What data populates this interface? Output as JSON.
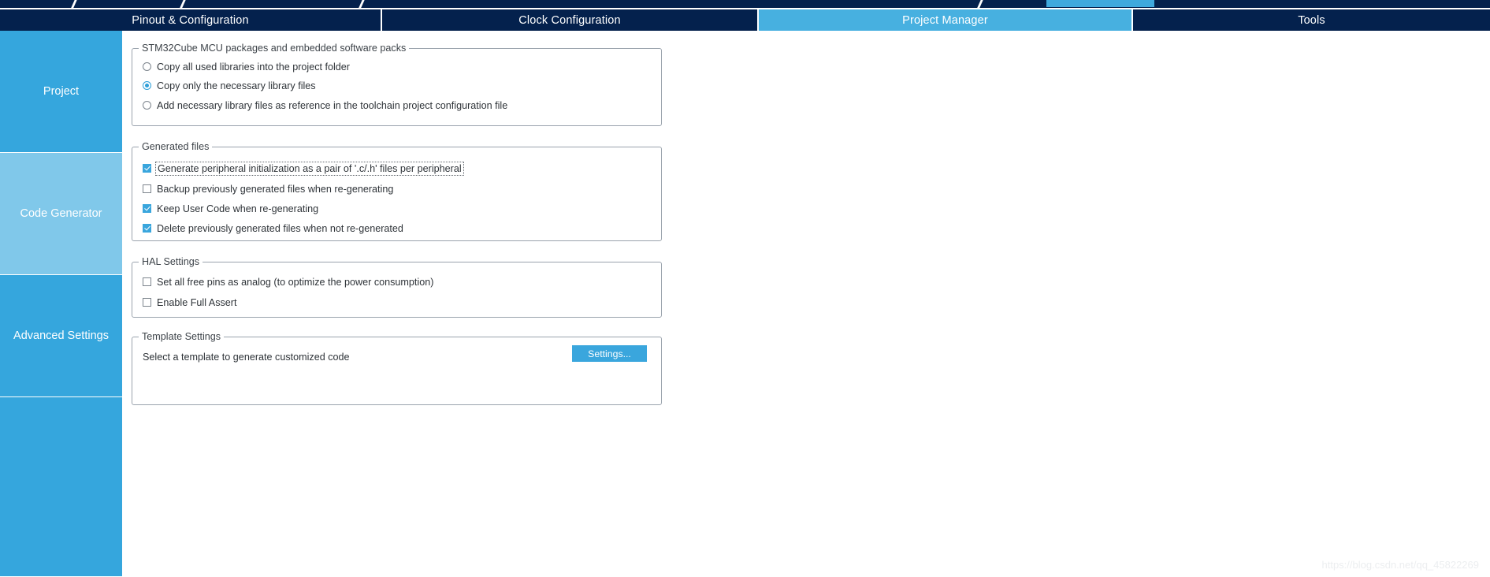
{
  "topbar": {
    "progress_chip_color": "#3fa9dd",
    "ribbon_color": "#04214d"
  },
  "tabs": [
    {
      "label": "Pinout & Configuration",
      "active": false
    },
    {
      "label": "Clock Configuration",
      "active": false
    },
    {
      "label": "Project Manager",
      "active": true
    },
    {
      "label": "Tools",
      "active": false
    }
  ],
  "sidebar": {
    "items": [
      {
        "label": "Project",
        "selected": false
      },
      {
        "label": "Code Generator",
        "selected": true
      },
      {
        "label": "Advanced Settings",
        "selected": false
      },
      {
        "label": "",
        "selected": false
      }
    ]
  },
  "groups": {
    "mcu_packages": {
      "title": "STM32Cube MCU packages and embedded software packs",
      "options": [
        {
          "label": "Copy all used libraries into the project folder",
          "checked": false
        },
        {
          "label": "Copy only the necessary library files",
          "checked": true
        },
        {
          "label": "Add necessary library files as reference in the toolchain project configuration file",
          "checked": false
        }
      ]
    },
    "generated_files": {
      "title": "Generated files",
      "options": [
        {
          "label": "Generate peripheral initialization as a pair of '.c/.h' files per peripheral",
          "checked": true,
          "focused": true
        },
        {
          "label": "Backup previously generated files when re-generating",
          "checked": false,
          "focused": false
        },
        {
          "label": "Keep User Code when re-generating",
          "checked": true,
          "focused": false
        },
        {
          "label": "Delete previously generated files when not re-generated",
          "checked": true,
          "focused": false
        }
      ]
    },
    "hal_settings": {
      "title": "HAL Settings",
      "options": [
        {
          "label": "Set all free pins as analog (to optimize the power consumption)",
          "checked": false
        },
        {
          "label": "Enable Full Assert",
          "checked": false
        }
      ]
    },
    "template_settings": {
      "title": "Template Settings",
      "description": "Select a template to generate customized code",
      "button_label": "Settings..."
    }
  },
  "watermark": {
    "text": "https://blog.csdn.net/qq_45822269"
  },
  "colors": {
    "tab_inactive": "#04214d",
    "tab_active": "#47b0e0",
    "sidebar_item": "#35a6dd",
    "sidebar_selected": "#80c8ea",
    "accent": "#3aa6dd"
  }
}
